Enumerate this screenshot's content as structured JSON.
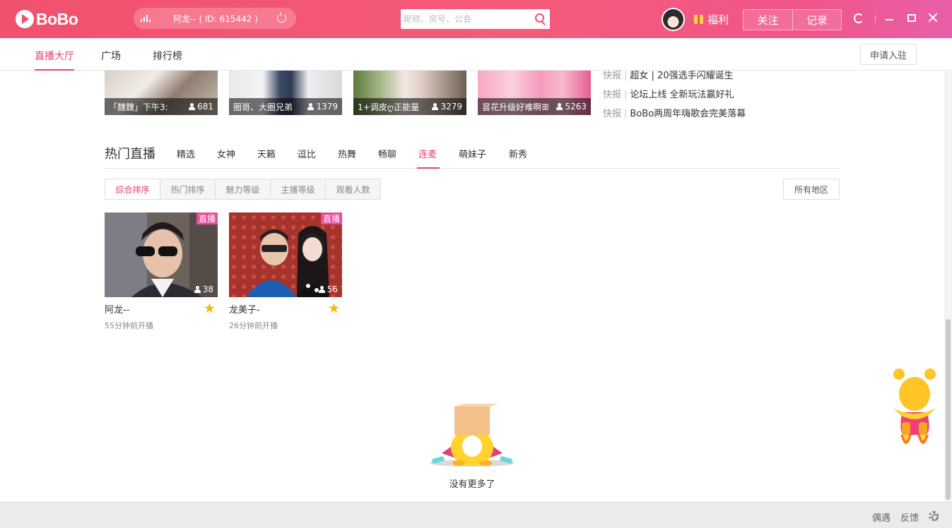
{
  "app": {
    "logo_text": "BoBo"
  },
  "titlebar": {
    "user_pill": "阿龙-- ( ID: 615442 )",
    "search_placeholder": "昵称、房号、公会",
    "gift_label": "福利",
    "follow_label": "关注",
    "record_label": "记录",
    "accent_color": "#f0516e"
  },
  "nav": {
    "items": [
      "直播大厅",
      "广场",
      "排行榜"
    ],
    "apply_label": "申请入驻"
  },
  "banners": [
    {
      "caption": "「魏魏」下午3:",
      "viewers": "681"
    },
    {
      "caption": "圈哥、大圈兄弟",
      "viewers": "1379"
    },
    {
      "caption": "1+调皮ღ正能量",
      "viewers": "3279"
    },
    {
      "caption": "昙花升级好难啊ꕥ",
      "viewers": "5263"
    }
  ],
  "news": [
    {
      "tag": "快报",
      "text": "超女 | 20强选手闪耀诞生"
    },
    {
      "tag": "快报",
      "text": "论坛上线 全新玩法赢好礼"
    },
    {
      "tag": "快报",
      "text": "BoBo两周年嗨歌会完美落幕"
    }
  ],
  "hot": {
    "title": "热门直播",
    "categories": [
      "精选",
      "女神",
      "天籁",
      "逗比",
      "热舞",
      "畅聊",
      "连麦",
      "萌妹子",
      "新秀"
    ],
    "active_category": "连麦",
    "sorts": [
      "综合排序",
      "热门排序",
      "魅力等级",
      "主播等级",
      "观看人数"
    ],
    "region_label": "所有地区"
  },
  "rooms": [
    {
      "name": "阿龙--",
      "time": "55分钟前开播",
      "viewers": "38",
      "badge": "直播"
    },
    {
      "name": "龙美子-",
      "time": "26分钟前开播",
      "viewers": "56",
      "badge": "直播"
    }
  ],
  "empty_text": "没有更多了",
  "statusbar": {
    "meet_label": "偶遇",
    "feedback_label": "反馈"
  },
  "icons": [
    "signal-icon",
    "power-icon",
    "search-icon",
    "gift-icon",
    "refresh-icon",
    "minimize-icon",
    "maximize-icon",
    "close-icon",
    "person-icon",
    "star-icon",
    "gear-icon"
  ]
}
